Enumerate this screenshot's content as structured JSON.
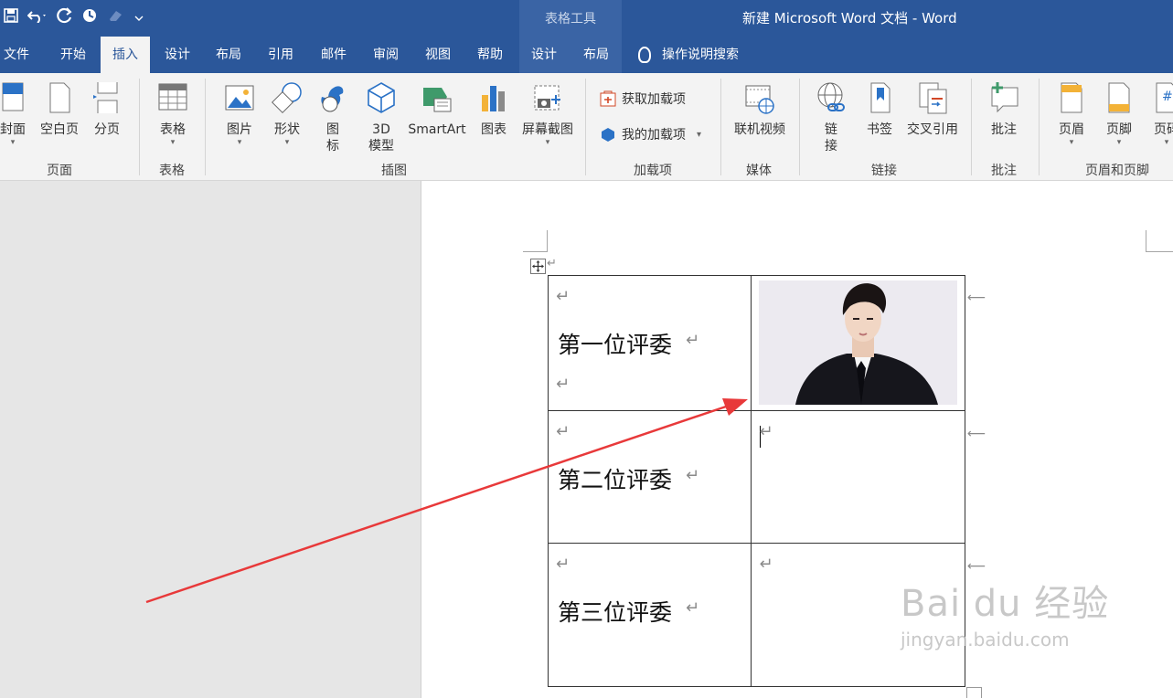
{
  "titlebar": {
    "context_tab": "表格工具",
    "document_title": "新建 Microsoft Word 文档  -  Word"
  },
  "tabs": {
    "file": "文件",
    "home": "开始",
    "insert": "插入",
    "design": "设计",
    "layout": "布局",
    "references": "引用",
    "mailings": "邮件",
    "review": "审阅",
    "view": "视图",
    "help": "帮助",
    "table_design": "设计",
    "table_layout": "布局",
    "search": "操作说明搜索",
    "active": "insert"
  },
  "ribbon": {
    "cover": "封面",
    "blank_page": "空白页",
    "page_break": "分页",
    "pages_group": "页面",
    "table": "表格",
    "tables_group": "表格",
    "pictures": "图片",
    "shapes": "形状",
    "icons_line1": "图",
    "icons_line2": "标",
    "model3d_line1": "3D",
    "model3d_line2": "模型",
    "smartart": "SmartArt",
    "chart": "图表",
    "screenshot": "屏幕截图",
    "illustrations_group": "插图",
    "get_addins": "获取加载项",
    "my_addins": "我的加载项",
    "addins_group": "加载项",
    "online_video": "联机视频",
    "media_group": "媒体",
    "link_line1": "链",
    "link_line2": "接",
    "bookmark": "书签",
    "cross_reference": "交叉引用",
    "links_group": "链接",
    "comment": "批注",
    "comments_group": "批注",
    "header": "页眉",
    "footer": "页脚",
    "page_number": "页码",
    "header_footer_group": "页眉和页脚"
  },
  "document": {
    "rows": [
      {
        "label": "第一位评委",
        "has_photo": true
      },
      {
        "label": "第二位评委",
        "has_photo": false
      },
      {
        "label": "第三位评委",
        "has_photo": false
      }
    ],
    "paragraph_mark": "↵"
  },
  "watermark": {
    "main": "Bai du 经验",
    "sub": "jingyan.baidu.com"
  },
  "colors": {
    "accent": "#2b579a",
    "arrow": "#e8393a"
  }
}
